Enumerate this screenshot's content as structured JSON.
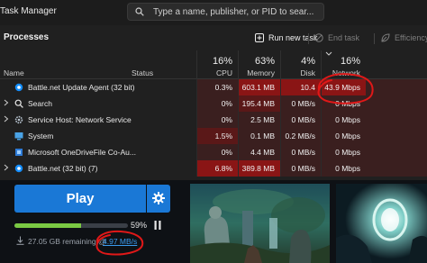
{
  "window": {
    "title": "Task Manager",
    "search_placeholder": "Type a name, publisher, or PID to sear..."
  },
  "toolbar": {
    "page_title": "Processes",
    "run_new_task": "Run new task",
    "end_task": "End task",
    "efficiency_mode": "Efficiency m"
  },
  "columns": {
    "name": "Name",
    "status": "Status",
    "cpu": {
      "pct": "16%",
      "label": "CPU"
    },
    "memory": {
      "pct": "63%",
      "label": "Memory"
    },
    "disk": {
      "pct": "4%",
      "label": "Disk"
    },
    "network": {
      "pct": "16%",
      "label": "Network"
    }
  },
  "processes": [
    {
      "name": "Battle.net Update Agent (32 bit)",
      "cpu": "0.3%",
      "memory": "603.1 MB",
      "disk": "10.4 MB/s",
      "network": "43.9 Mbps",
      "expandable": false,
      "icon": "battlenet-icon"
    },
    {
      "name": "Search",
      "cpu": "0%",
      "memory": "195.4 MB",
      "disk": "0 MB/s",
      "network": "0 Mbps",
      "expandable": true,
      "icon": "search-app-icon"
    },
    {
      "name": "Service Host: Network Service",
      "cpu": "0%",
      "memory": "2.5 MB",
      "disk": "0 MB/s",
      "network": "0 Mbps",
      "expandable": true,
      "icon": "service-host-icon"
    },
    {
      "name": "System",
      "cpu": "1.5%",
      "memory": "0.1 MB",
      "disk": "0.2 MB/s",
      "network": "0 Mbps",
      "expandable": false,
      "icon": "system-icon"
    },
    {
      "name": "Microsoft OneDriveFile Co-Au...",
      "cpu": "0%",
      "memory": "4.4 MB",
      "disk": "0 MB/s",
      "network": "0 Mbps",
      "expandable": false,
      "icon": "onedrive-icon"
    },
    {
      "name": "Battle.net (32 bit) (7)",
      "cpu": "6.8%",
      "memory": "389.8 MB",
      "disk": "0 MB/s",
      "network": "0 Mbps",
      "expandable": true,
      "icon": "battlenet-icon"
    }
  ],
  "launcher": {
    "play_label": "Play",
    "progress_label": "59%",
    "progress_value": 0.59,
    "remaining": "27.05 GB remaining @",
    "speed": "4.97 MB/s"
  },
  "colors": {
    "accent": "#1a78d6",
    "progress": "#7ac943",
    "heat_high": "#8a1515",
    "heat_mid": "#5a1818",
    "heat_low": "#3a1f1f",
    "annotation": "#e01818"
  }
}
